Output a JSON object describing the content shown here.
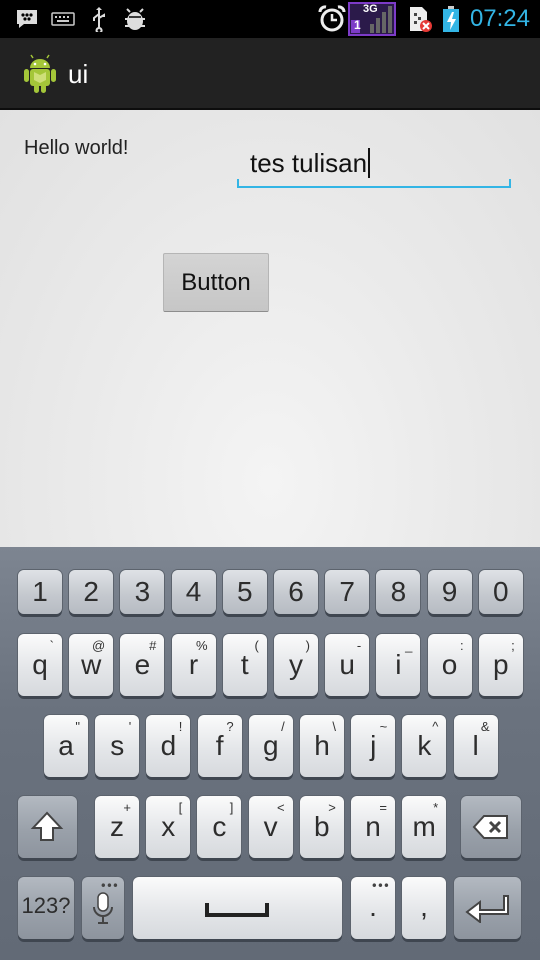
{
  "status_bar": {
    "time": "07:24",
    "network_type": "3G",
    "sim_slot": "1",
    "time_color": "#33b5e5",
    "icons": [
      "bbm-icon",
      "keyboard-icon",
      "usb-icon",
      "debug-icon",
      "alarm-icon",
      "signal-icon",
      "sim-error-icon",
      "battery-charging-icon"
    ]
  },
  "action_bar": {
    "title": "ui",
    "logo": "android-logo-icon"
  },
  "content": {
    "hello_text": "Hello world!",
    "edit_value": "tes tulisan",
    "button_label": "Button",
    "accent_color": "#33b5e5"
  },
  "keyboard": {
    "number_row": [
      "1",
      "2",
      "3",
      "4",
      "5",
      "6",
      "7",
      "8",
      "9",
      "0"
    ],
    "row1": [
      {
        "main": "q",
        "sub": "`"
      },
      {
        "main": "w",
        "sub": "@"
      },
      {
        "main": "e",
        "sub": "#"
      },
      {
        "main": "r",
        "sub": "%"
      },
      {
        "main": "t",
        "sub": "("
      },
      {
        "main": "y",
        "sub": ")"
      },
      {
        "main": "u",
        "sub": "-"
      },
      {
        "main": "i",
        "sub": "_"
      },
      {
        "main": "o",
        "sub": ":"
      },
      {
        "main": "p",
        "sub": ";"
      }
    ],
    "row2": [
      {
        "main": "a",
        "sub": "\""
      },
      {
        "main": "s",
        "sub": "'"
      },
      {
        "main": "d",
        "sub": "!"
      },
      {
        "main": "f",
        "sub": "?"
      },
      {
        "main": "g",
        "sub": "/"
      },
      {
        "main": "h",
        "sub": "\\"
      },
      {
        "main": "j",
        "sub": "~"
      },
      {
        "main": "k",
        "sub": "^"
      },
      {
        "main": "l",
        "sub": "&"
      }
    ],
    "row3": [
      {
        "main": "z",
        "sub": "+"
      },
      {
        "main": "x",
        "sub": "["
      },
      {
        "main": "c",
        "sub": "]"
      },
      {
        "main": "v",
        "sub": "<"
      },
      {
        "main": "b",
        "sub": ">"
      },
      {
        "main": "n",
        "sub": "="
      },
      {
        "main": "m",
        "sub": "*"
      }
    ],
    "mode_label": "123?",
    "period_label": ".",
    "comma_label": ","
  }
}
